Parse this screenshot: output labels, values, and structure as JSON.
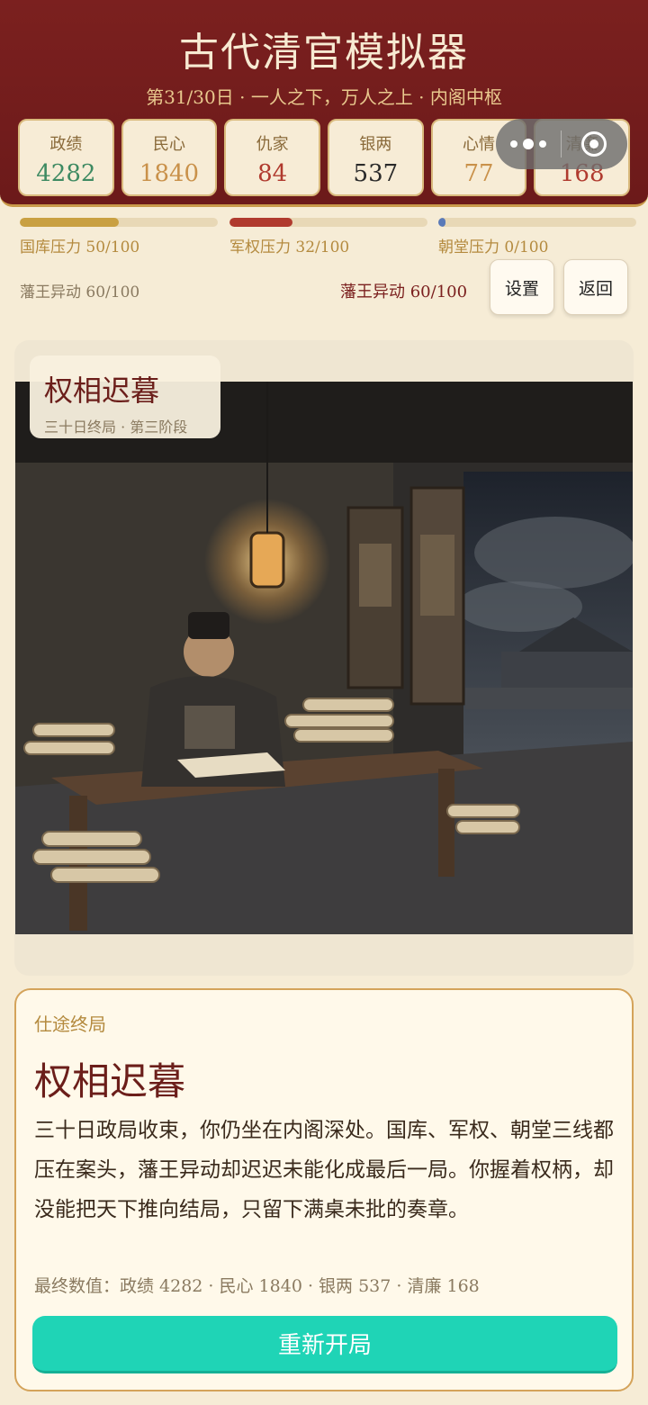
{
  "header": {
    "title": "古代清官模拟器",
    "subtitle": "第31/30日 · 一人之下，万人之上 · 内阁中枢"
  },
  "stats": [
    {
      "label": "政绩",
      "value": "4282",
      "color": "#3e8a62"
    },
    {
      "label": "民心",
      "value": "1840",
      "color": "#c9914a"
    },
    {
      "label": "仇家",
      "value": "84",
      "color": "#b03a2e"
    },
    {
      "label": "银两",
      "value": "537",
      "color": "#2a2a2a"
    },
    {
      "label": "心情",
      "value": "77",
      "color": "#c9914a"
    },
    {
      "label": "清廉",
      "value": "168",
      "color": "#b03a2e"
    }
  ],
  "pressures": [
    {
      "label": "国库压力 50/100",
      "level": 0.5,
      "color": "#c9a042"
    },
    {
      "label": "军权压力 32/100",
      "level": 0.32,
      "color": "#b03a2e"
    },
    {
      "label": "朝堂压力 0/100",
      "level": 0.0,
      "color": "#5a7ab8"
    }
  ],
  "rebel": {
    "left_label": "藩王异动 60/100",
    "right_label": "藩王异动 60/100"
  },
  "buttons": {
    "settings": "设置",
    "back": "返回",
    "restart": "重新开局"
  },
  "scene": {
    "title": "权相迟暮",
    "stage": "三十日终局 · 第三阶段"
  },
  "ending": {
    "kicker": "仕途终局",
    "title": "权相迟暮",
    "body": "三十日政局收束，你仍坐在内阁深处。国库、军权、朝堂三线都压在案头，藩王异动却迟迟未能化成最后一局。你握着权柄，却没能把天下推向结局，只留下满桌未批的奏章。",
    "final_stats": "最终数值：政绩 4282 · 民心 1840 · 银两 537 · 清廉 168"
  },
  "capsule": {
    "menu_icon": "more-dots-icon",
    "close_icon": "close-miniprogram-icon"
  },
  "colors": {
    "header_bg": "#7b201f",
    "accent": "#1fd4b6",
    "page_bg": "#f6ecd6"
  }
}
